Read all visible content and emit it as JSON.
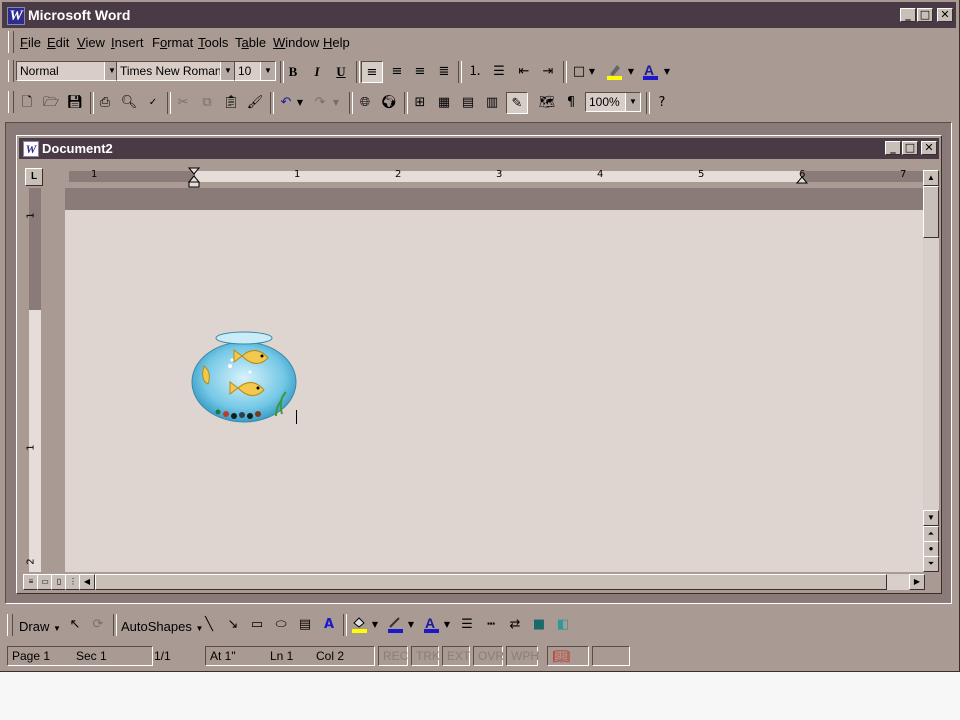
{
  "app": {
    "title": "Microsoft Word",
    "icon_letter": "W"
  },
  "menu": [
    "File",
    "Edit",
    "View",
    "Insert",
    "Format",
    "Tools",
    "Table",
    "Window",
    "Help"
  ],
  "menu_accel": [
    "F",
    "E",
    "V",
    "I",
    "o",
    "T",
    "a",
    "W",
    "H"
  ],
  "formatting": {
    "style": "Normal",
    "font": "Times New Roman",
    "size": "10",
    "bold": "B",
    "italic": "I",
    "underline": "U"
  },
  "standard": {
    "zoom": "100%"
  },
  "document": {
    "title": "Document2",
    "picture_alt": "fishbowl clip art"
  },
  "ruler": {
    "numbers": [
      "1",
      "1",
      "2",
      "3",
      "4",
      "5",
      "6",
      "7"
    ]
  },
  "vruler": {
    "numbers": [
      "1",
      "1",
      "2"
    ]
  },
  "drawing": {
    "draw_label": "Draw",
    "autoshapes_label": "AutoShapes"
  },
  "status": {
    "page": "Page  1",
    "sec": "Sec  1",
    "pages": "1/1",
    "at": "At  1\"",
    "ln": "Ln  1",
    "col": "Col  2",
    "rec": "REC",
    "trk": "TRK",
    "ext": "EXT",
    "ovr": "OVR",
    "wph": "WPH"
  },
  "colors": {
    "title_bar": "#4a3a46",
    "chrome": "#a99a93",
    "page": "#ded5d1"
  }
}
